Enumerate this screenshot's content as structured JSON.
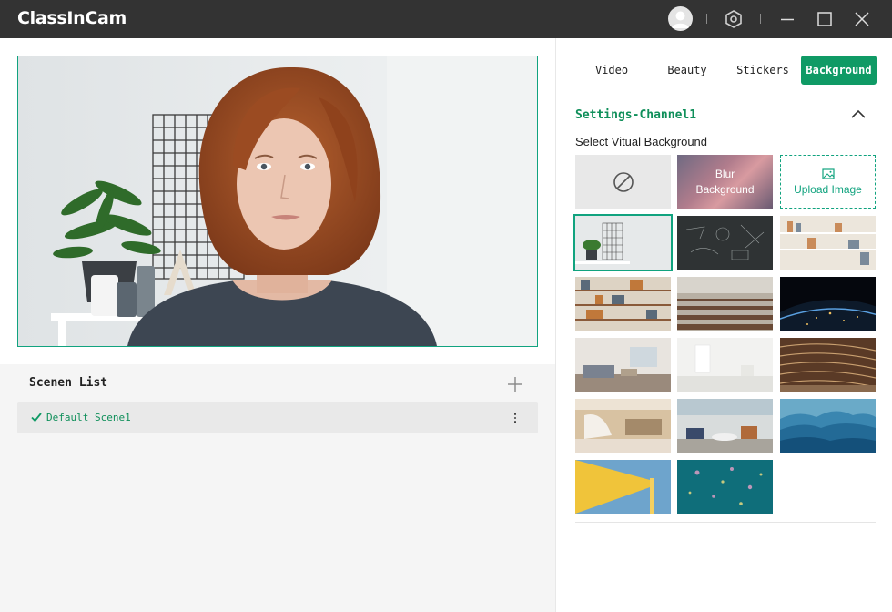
{
  "app": {
    "title": "ClassInCam"
  },
  "titlebar": {
    "icons": [
      "avatar-icon",
      "settings-hex-icon",
      "minimize-icon",
      "maximize-icon",
      "close-icon"
    ]
  },
  "scenes": {
    "title": "Scenen List",
    "items": [
      {
        "name": "Default Scene1",
        "active": true
      }
    ]
  },
  "tabs": [
    {
      "label": "Video",
      "active": false
    },
    {
      "label": "Beauty",
      "active": false
    },
    {
      "label": "Stickers",
      "active": false
    },
    {
      "label": "Background",
      "active": true
    }
  ],
  "settings": {
    "title": "Settings-Channel1",
    "select_label": "Select Vitual Background",
    "blur_label": "Blur\nBackground",
    "upload_label": "Upload Image"
  },
  "backgrounds": [
    "none",
    "blur",
    "upload",
    "white-room-grid",
    "blackboard",
    "bookshelf-white",
    "living-room-shelf",
    "lecture-hall",
    "earth-night",
    "modern-living-room",
    "white-studio",
    "library-curved",
    "office-lobby",
    "office-lounge",
    "blue-mountains",
    "yellow-pencil",
    "teal-bokeh"
  ],
  "colors": {
    "accent": "#0f9a65",
    "titlebar": "#333333"
  }
}
